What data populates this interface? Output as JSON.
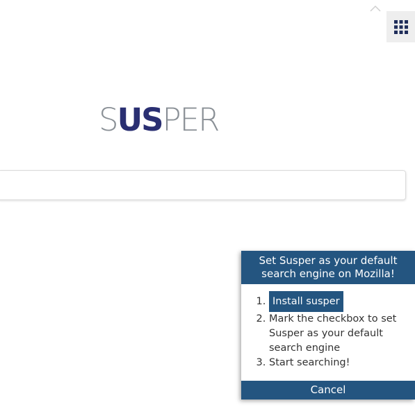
{
  "header": {
    "collapse_icon": "chevron-up-icon",
    "apps_icon": "grid-icon"
  },
  "logo": {
    "part1": "S",
    "part2": "US",
    "part3": "PER",
    "grey_color": "#8a9096",
    "navy_color": "#2a2f72"
  },
  "search": {
    "value": "",
    "placeholder": ""
  },
  "popup": {
    "title": "Set Susper as your default search engine on Mozilla!",
    "install_label": "Install susper",
    "step2": "Mark the checkbox to set Susper as your default search engine",
    "step3": "Start searching!",
    "cancel_label": "Cancel",
    "accent_color": "#245580"
  }
}
